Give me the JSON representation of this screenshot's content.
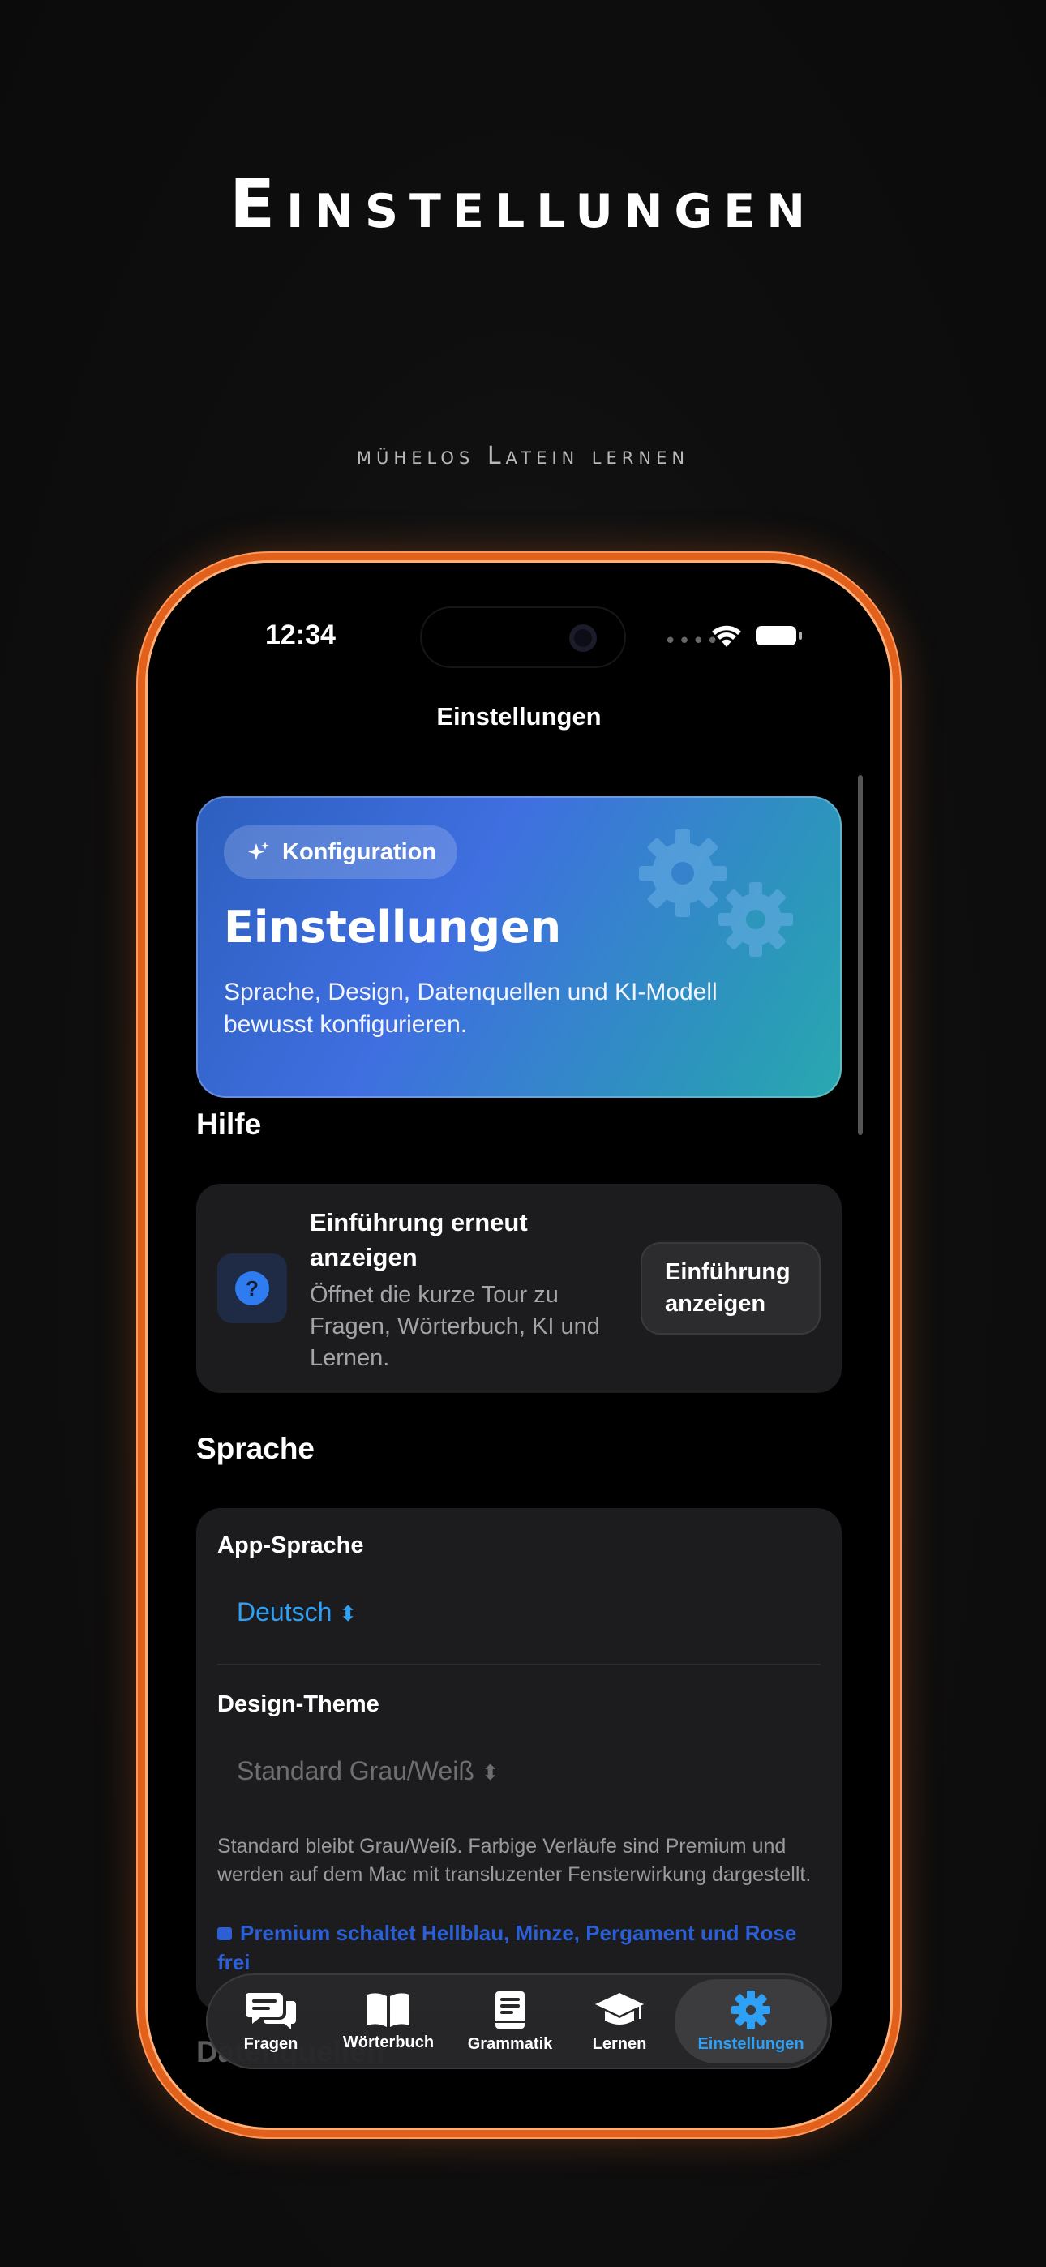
{
  "hero": {
    "title": "Einstellungen",
    "subtitle": "mühelos Latein lernen"
  },
  "status_bar": {
    "time": "12:34"
  },
  "nav": {
    "title": "Einstellungen"
  },
  "header_card": {
    "badge": "Konfiguration",
    "title": "Einstellungen",
    "description": "Sprache, Design, Datenquellen und KI-Modell bewusst konfigurieren."
  },
  "help": {
    "section_title": "Hilfe",
    "title": "Einführung erneut anzeigen",
    "description": "Öffnet die kurze Tour zu Fragen, Wörterbuch, KI und Lernen.",
    "button": "Einführung anzeigen"
  },
  "language": {
    "section_title": "Sprache",
    "app_language_label": "App-Sprache",
    "app_language_value": "Deutsch",
    "theme_label": "Design-Theme",
    "theme_value": "Standard Grau/Weiß",
    "theme_note": "Standard bleibt Grau/Weiß. Farbige Verläufe sind Premium und werden auf dem Mac mit transluzenter Fensterwirkung dargestellt.",
    "premium_note": "Premium schaltet Hellblau, Minze, Pergament und Rose frei"
  },
  "next_section": "Datenquellen",
  "tabs": [
    {
      "label": "Fragen",
      "icon": "chat-bubbles-icon"
    },
    {
      "label": "Wörterbuch",
      "icon": "book-icon"
    },
    {
      "label": "Grammatik",
      "icon": "grammar-book-icon"
    },
    {
      "label": "Lernen",
      "icon": "graduation-cap-icon"
    },
    {
      "label": "Einstellungen",
      "icon": "gear-icon",
      "active": true
    }
  ],
  "colors": {
    "accent": "#2ea0f5",
    "phone_frame": "#e0601c",
    "card_gradient_start": "#2d5fbf",
    "card_gradient_end": "#2aa8b0",
    "premium_link": "#2c5fd6"
  }
}
